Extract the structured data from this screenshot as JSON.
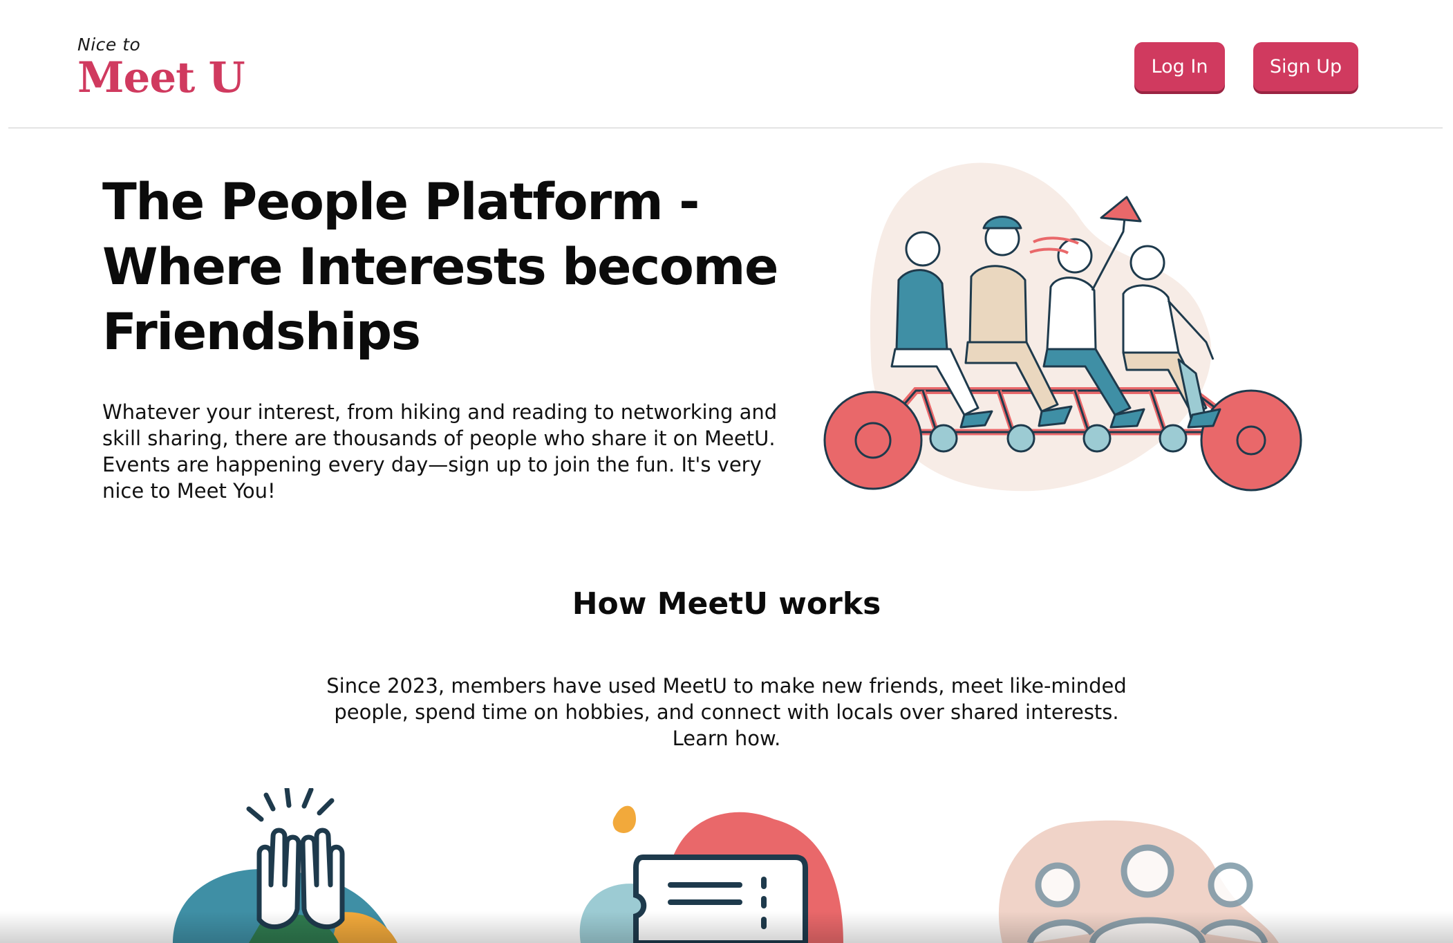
{
  "header": {
    "logo_small": "Nice to",
    "logo_big": "Meet U",
    "login_label": "Log In",
    "signup_label": "Sign Up"
  },
  "hero": {
    "title_line1": "The People Platform -",
    "title_line2": "Where Interests become",
    "title_line3": "Friendships",
    "description": "Whatever your interest, from hiking and reading to networking and skill sharing, there are thousands of people who share it on MeetU. Events are happening every day—sign up to join the fun. It's very nice to Meet You!",
    "illustration_icon": "tandem-bicycle-illustration"
  },
  "how_it_works": {
    "title": "How MeetU works",
    "description": "Since 2023, members have used MeetU to make new friends, meet like-minded people, spend time on hobbies, and connect with locals over shared interests. Learn how.",
    "cards": [
      {
        "icon": "high-five-hands-icon"
      },
      {
        "icon": "ticket-icon"
      },
      {
        "icon": "group-people-icon"
      }
    ]
  },
  "colors": {
    "brand": "#d03a5f",
    "brand_shadow": "#9a2442",
    "wheel": "#e9686a",
    "teal": "#3f8fa5",
    "light_teal": "#9ccbd3",
    "blob": "#f7ece6",
    "ink": "#1e3a4c",
    "orange": "#f2a93b"
  }
}
